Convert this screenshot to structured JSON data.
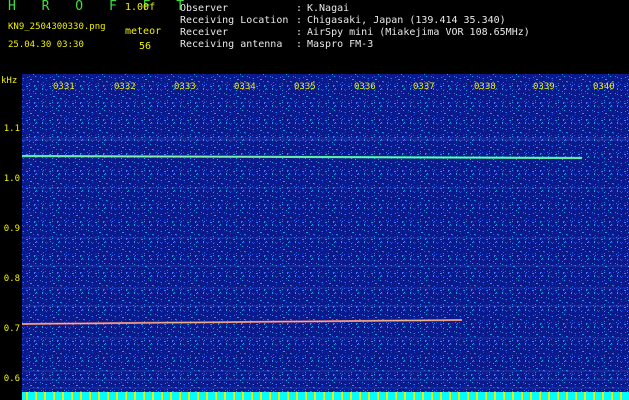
{
  "header": {
    "brand": "H R O F F T",
    "version": "1.00f",
    "filename": "KN9_2504300330.png",
    "timestamp": "25.04.30 03:30",
    "meteor_label": "meteor",
    "meteor_count": "56",
    "info": [
      {
        "label": "Observer",
        "value": "K.Nagai"
      },
      {
        "label": "Receiving Location",
        "value": "Chigasaki, Japan (139.414 35.340)"
      },
      {
        "label": "Receiver",
        "value": "AirSpy mini (Miakejima VOR 108.65MHz)"
      },
      {
        "label": "Receiving antenna",
        "value": "Maspro FM-3"
      }
    ]
  },
  "spectrogram": {
    "y_unit": "kHz",
    "y_ticks": [
      "1.1",
      "1.0",
      "0.9",
      "0.8",
      "0.7",
      "0.6"
    ],
    "time_ticks": [
      "0331",
      "0332",
      "0333",
      "0334",
      "0335",
      "0336",
      "0337",
      "0338",
      "0339",
      "0340"
    ],
    "colors": {
      "background": "#0a1a8c",
      "text": "#f0f000",
      "signal": "#40e0a0",
      "baseline": "#00ffff"
    }
  }
}
